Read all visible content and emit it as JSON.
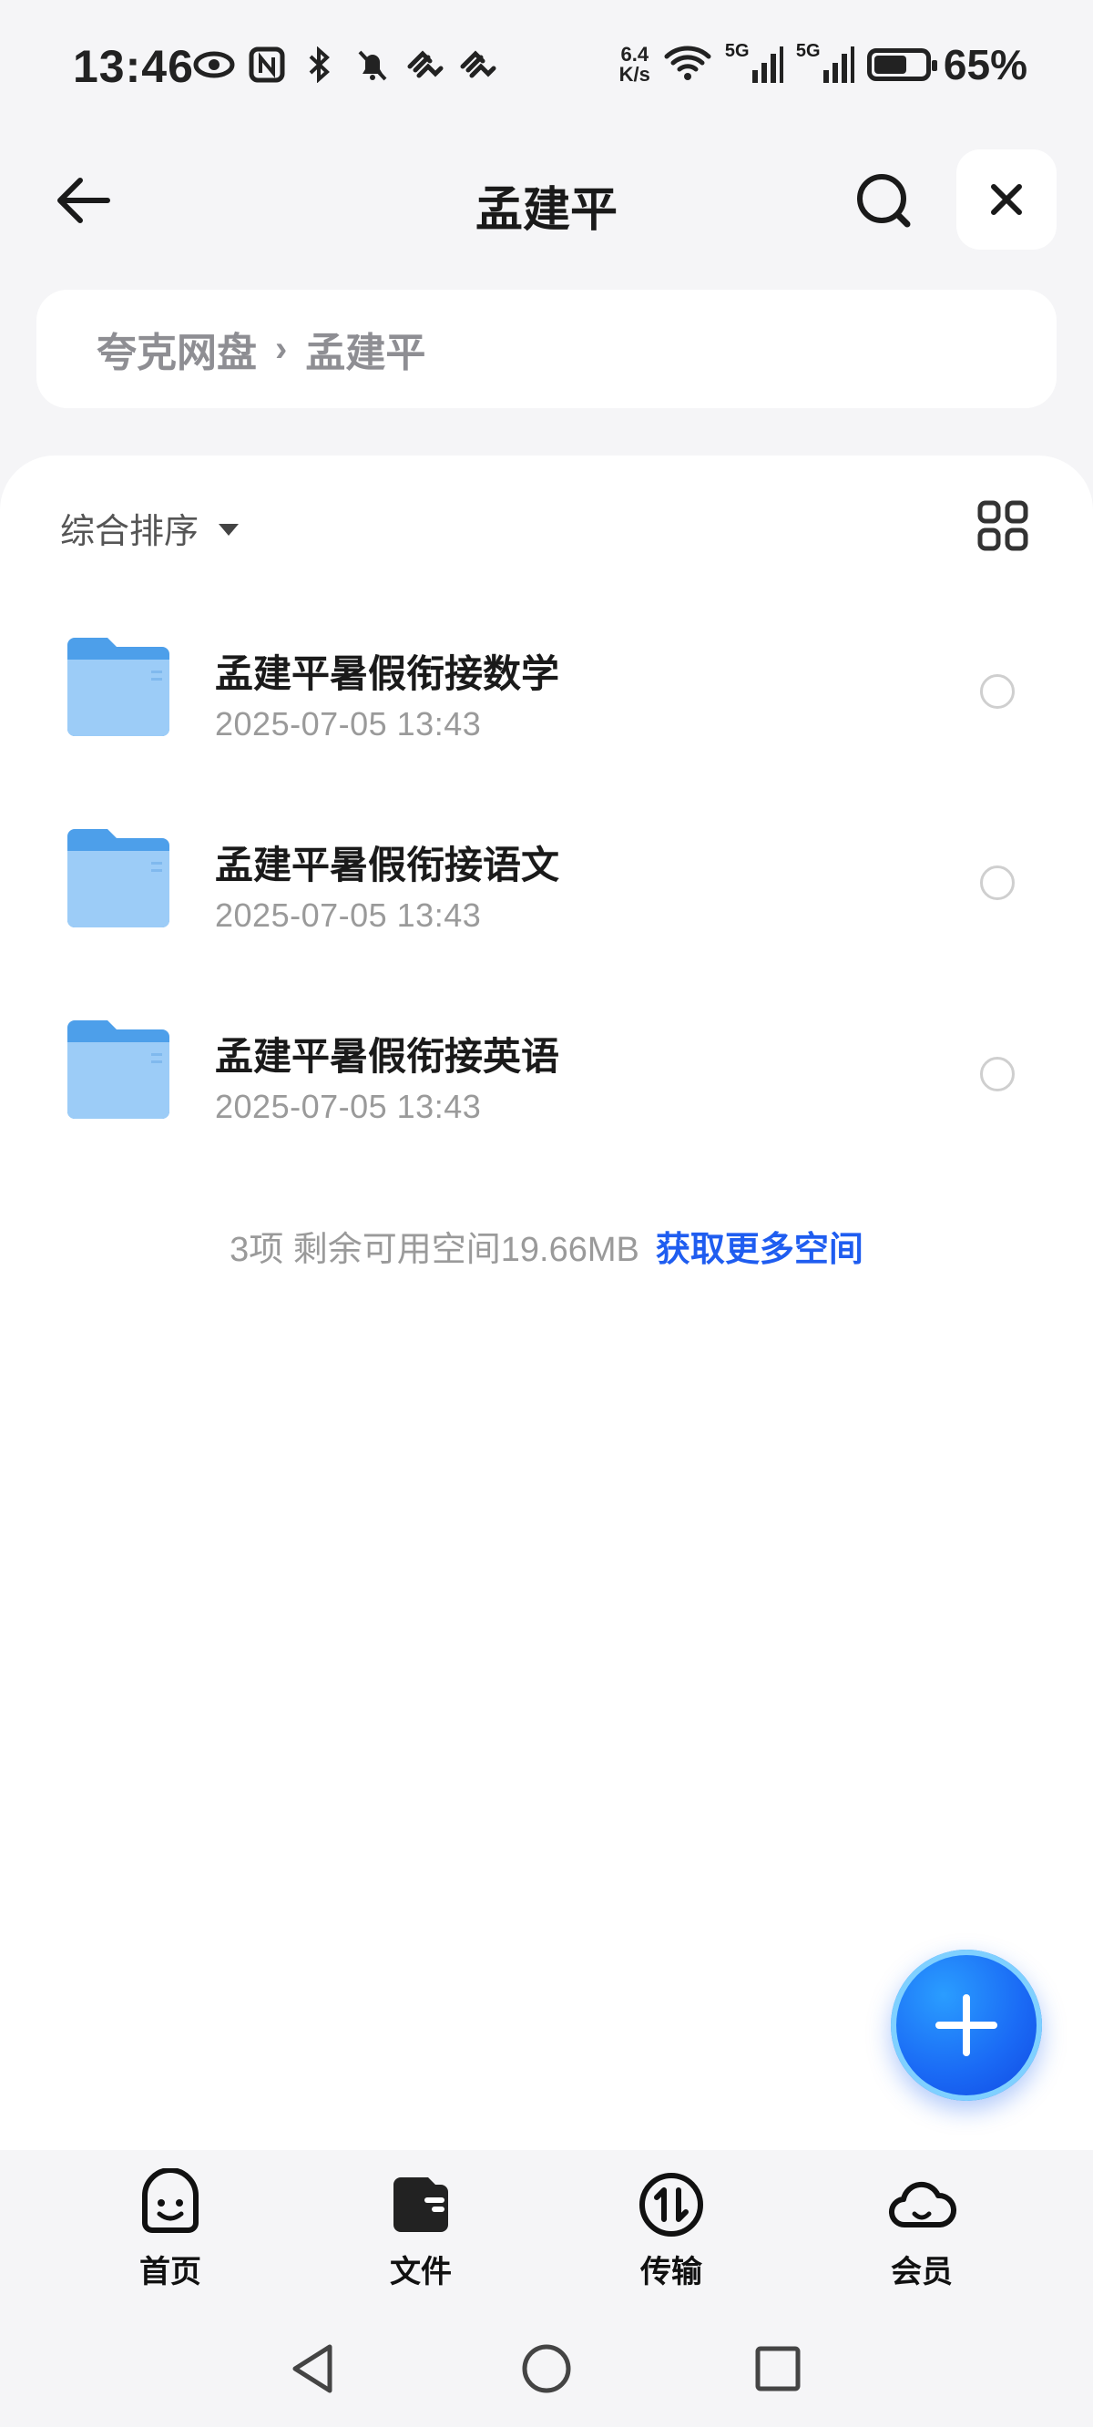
{
  "status_bar": {
    "time": "13:46",
    "net_speed_value": "6.4",
    "net_speed_unit": "K/s",
    "battery_percent": "65%",
    "battery_level": 0.65,
    "signal_1": "5G",
    "signal_2": "5G"
  },
  "header": {
    "title": "孟建平",
    "icons": [
      "back-arrow-icon",
      "search-icon",
      "close-icon"
    ]
  },
  "breadcrumb": {
    "items": [
      "夸克网盘",
      "孟建平"
    ]
  },
  "toolbar": {
    "sort_label": "综合排序"
  },
  "files": [
    {
      "name": "孟建平暑假衔接数学",
      "date": "2025-07-05 13:43",
      "type": "folder"
    },
    {
      "name": "孟建平暑假衔接语文",
      "date": "2025-07-05 13:43",
      "type": "folder"
    },
    {
      "name": "孟建平暑假衔接英语",
      "date": "2025-07-05 13:43",
      "type": "folder"
    }
  ],
  "summary": {
    "text": "3项 剩余可用空间19.66MB",
    "link": "获取更多空间"
  },
  "tabs": [
    {
      "label": "首页",
      "icon": "smiley-home-icon"
    },
    {
      "label": "文件",
      "icon": "wallet-file-icon"
    },
    {
      "label": "传输",
      "icon": "transfer-arrows-icon"
    },
    {
      "label": "会员",
      "icon": "cloud-member-icon"
    }
  ],
  "colors": {
    "accent": "#1f5df0",
    "folder": "#5aa9f0",
    "page_bg": "#f5f5f7"
  }
}
